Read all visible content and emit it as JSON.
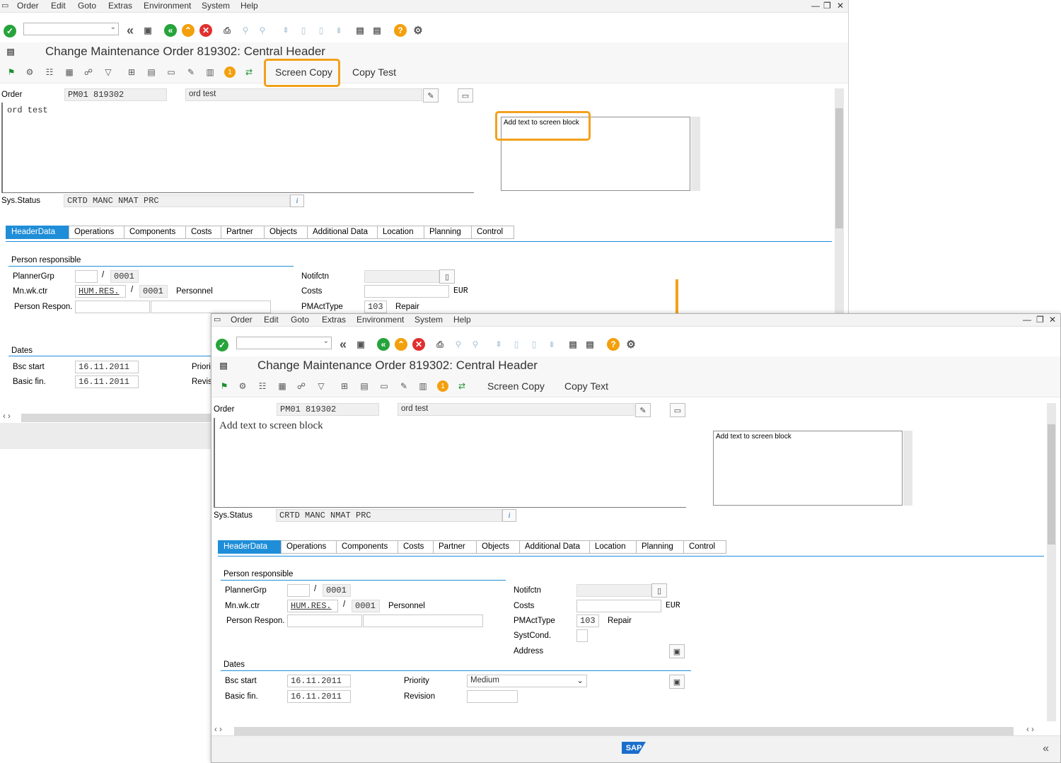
{
  "menu": {
    "order": "Order",
    "edit": "Edit",
    "goto": "Goto",
    "extras": "Extras",
    "environment": "Environment",
    "system": "System",
    "help": "Help"
  },
  "window_title": "Change Maintenance Order 819302: Central Header",
  "app_toolbar": {
    "screen_copy": "Screen Copy",
    "copy_test": "Copy Test",
    "copy_text": "Copy Text",
    "badge": "1"
  },
  "order": {
    "label": "Order",
    "type": "PM01",
    "number": "819302",
    "description": "ord test"
  },
  "long_text_before": "ord test",
  "long_text_after": "Add text to screen block",
  "text_block": "Add text to screen block",
  "sys_status": {
    "label": "Sys.Status",
    "value": "CRTD MANC NMAT PRC"
  },
  "tabs": [
    "HeaderData",
    "Operations",
    "Components",
    "Costs",
    "Partner",
    "Objects",
    "Additional Data",
    "Location",
    "Planning",
    "Control"
  ],
  "person": {
    "group": "Person responsible",
    "planner_grp": "PlannerGrp",
    "planner_plant": "0001",
    "slash": "/",
    "mn_wk_ctr": "Mn.wk.ctr",
    "wk_ctr_value": "HUM.RES.",
    "wk_ctr_plant": "0001",
    "wk_ctr_text": "Personnel",
    "person_respon": "Person Respon."
  },
  "right": {
    "notifctn": "Notifctn",
    "costs": "Costs",
    "currency": "EUR",
    "pmacttype": "PMActType",
    "pmacttype_value": "103",
    "pmacttype_text": "Repair",
    "systcond": "SystCond.",
    "address": "Address"
  },
  "dates": {
    "group": "Dates",
    "bsc_start": "Bsc start",
    "bsc_start_value": "16.11.2011",
    "basic_fin": "Basic fin.",
    "basic_fin_value": "16.11.2011",
    "priority": "Priority",
    "priority_value": "Medium",
    "revision": "Revision",
    "priority_short": "Priorit",
    "revision_short": "Revisi"
  },
  "sap_logo": "SAP",
  "colors": {
    "accent": "#1f8ed8",
    "highlight": "#f2a11c",
    "green": "#27a33b",
    "red": "#e12f2f"
  }
}
